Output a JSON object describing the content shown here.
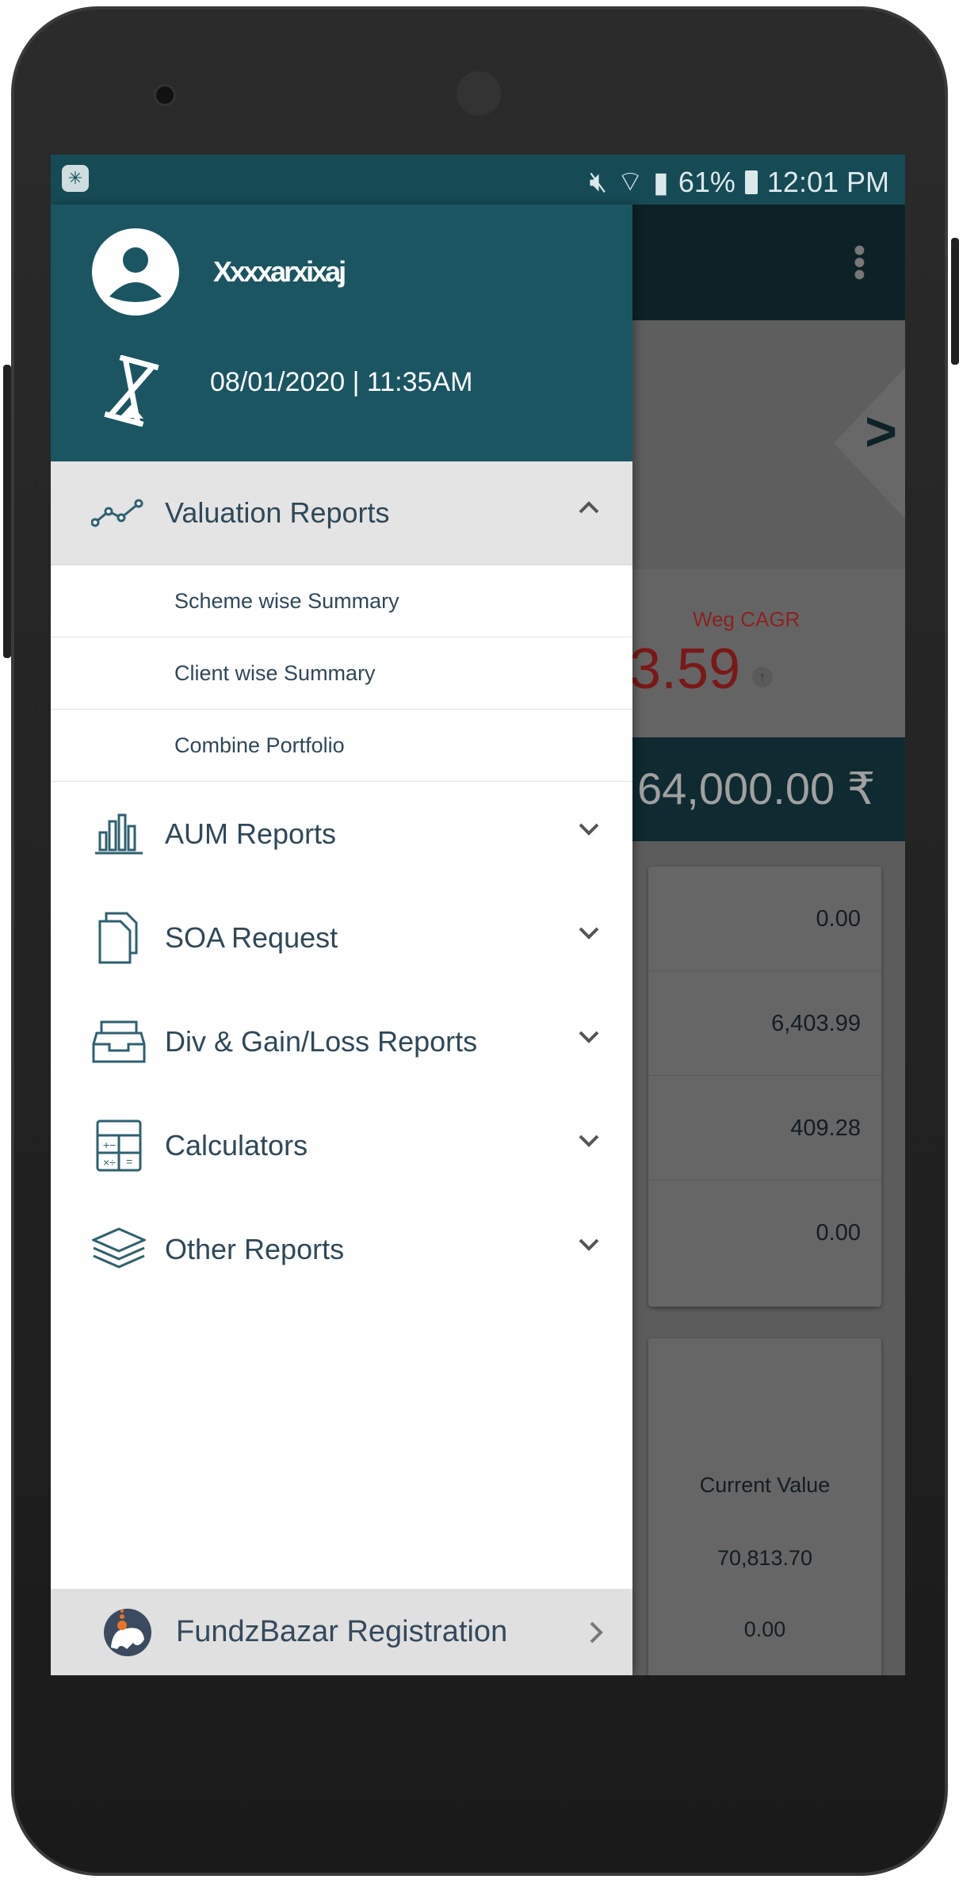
{
  "status_bar": {
    "battery": "61%",
    "time": "12:01 PM",
    "icons": [
      "mute-icon",
      "wifi-icon",
      "signal-icon",
      "battery-charging-icon"
    ]
  },
  "background_screen": {
    "cagr_label": "Weg CAGR",
    "cagr_value": "3.59",
    "total_value": "64,000.00 ₹",
    "summary_values": [
      "0.00",
      "6,403.99",
      "409.28",
      "0.00"
    ],
    "table_header": "Current Value",
    "table_values": [
      "70,813.70",
      "0.00"
    ]
  },
  "drawer": {
    "user_name": "Xxxxarxixaj",
    "last_login": "08/01/2020 | 11:35AM",
    "menu": [
      {
        "label": "Valuation Reports",
        "icon": "line-chart-icon",
        "expanded": true,
        "children": [
          "Scheme wise Summary",
          "Client wise Summary",
          "Combine Portfolio"
        ]
      },
      {
        "label": "AUM Reports",
        "icon": "bar-chart-icon"
      },
      {
        "label": "SOA Request",
        "icon": "documents-icon"
      },
      {
        "label": "Div & Gain/Loss Reports",
        "icon": "inbox-tray-icon"
      },
      {
        "label": "Calculators",
        "icon": "calculator-icon"
      },
      {
        "label": "Other Reports",
        "icon": "layers-icon"
      }
    ],
    "footer_label": "FundzBazar Registration",
    "colors": {
      "header": "#1b5562",
      "text": "#2f4858",
      "expanded_bg": "#e4e4e4",
      "footer_bg": "#e0e0e0"
    }
  }
}
